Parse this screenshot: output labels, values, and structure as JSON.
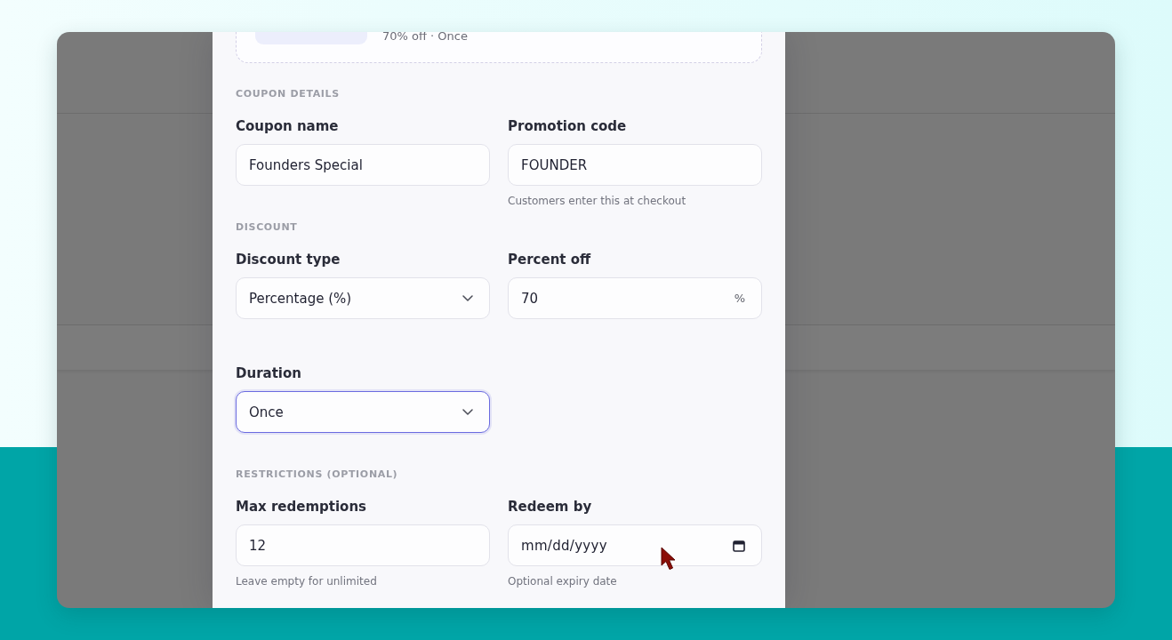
{
  "coupon_preview": {
    "summary": "70% off · Once"
  },
  "sections": [
    {
      "heading": "COUPON DETAILS",
      "fields": [
        {
          "kind": "text",
          "label": "Coupon name",
          "value": "Founders Special",
          "focused": false
        },
        {
          "kind": "text",
          "label": "Promotion code",
          "value": "FOUNDER",
          "hint": "Customers enter this at checkout",
          "focused": false
        }
      ]
    },
    {
      "heading": "DISCOUNT",
      "fields": [
        {
          "kind": "select",
          "label": "Discount type",
          "value": "Percentage (%)",
          "focused": false
        },
        {
          "kind": "number",
          "label": "Percent off",
          "value": "70",
          "suffix": "%",
          "focused": false
        },
        {
          "kind": "select",
          "label": "Duration",
          "value": "Once",
          "focused": true
        }
      ]
    },
    {
      "heading": "RESTRICTIONS (OPTIONAL)",
      "fields": [
        {
          "kind": "number",
          "label": "Max redemptions",
          "value": "12",
          "hint": "Leave empty for unlimited",
          "focused": false
        },
        {
          "kind": "date",
          "label": "Redeem by",
          "placeholder": "mm/dd/yyyy",
          "hint": "Optional expiry date",
          "focused": false
        }
      ]
    }
  ]
}
